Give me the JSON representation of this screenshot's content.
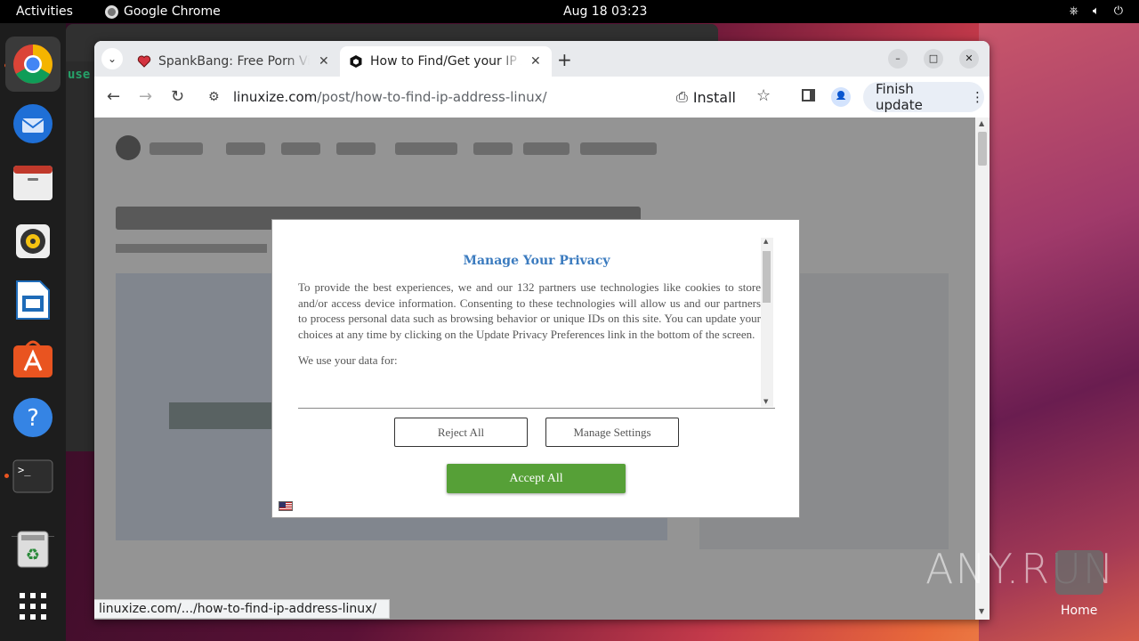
{
  "topbar": {
    "activities": "Activities",
    "app_name": "Google Chrome",
    "clock": "Aug 18  03:23"
  },
  "dock": {
    "items": [
      "chrome-icon",
      "thunderbird-icon",
      "files-icon",
      "rhythmbox-icon",
      "writer-icon",
      "app-center-icon",
      "help-icon",
      "terminal-icon",
      "trash-icon",
      "show-apps-icon"
    ]
  },
  "bg_terminal": {
    "text": "use"
  },
  "browser": {
    "tabs": [
      {
        "label": "SpankBang: Free Porn Videos",
        "active": false
      },
      {
        "label": "How to Find/Get your IP Address",
        "active": true
      }
    ],
    "url_host": "linuxize.com",
    "url_path": "/post/how-to-find-ip-address-linux/",
    "install_label": "Install",
    "finish_update_label": "Finish update",
    "status_url": "linuxize.com/.../how-to-find-ip-address-linux/"
  },
  "consent": {
    "title": "Manage Your Privacy",
    "body": "To provide the best experiences, we and our 132 partners use technologies like cookies to store and/or access device information. Consenting to these technologies will allow us and our partners to process personal data such as browsing behavior or unique IDs on this site. You can update your choices at any time by clicking on the Update Privacy Preferences link in the bottom of the screen.",
    "body2": "We use your data for:",
    "reject_label": "Reject All",
    "manage_label": "Manage Settings",
    "accept_label": "Accept All",
    "accept_color": "#56a037",
    "title_color": "#3b7bbf"
  },
  "watermark": "ANY.RUN",
  "desktop": {
    "home_label": "Home"
  }
}
